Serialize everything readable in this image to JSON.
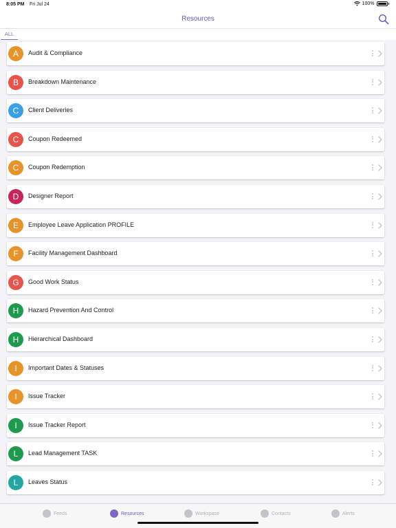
{
  "status_bar": {
    "time": "8:05 PM",
    "date": "Fri Jul 24",
    "battery": "100%"
  },
  "nav": {
    "title": "Resources"
  },
  "filter": {
    "tab": "ALL"
  },
  "items": [
    {
      "letter": "A",
      "label": "Audit & Compliance",
      "color": "#e8922a"
    },
    {
      "letter": "B",
      "label": "Breakdown Maintenance",
      "color": "#e8544c"
    },
    {
      "letter": "C",
      "label": "Client Deliveries",
      "color": "#3aa0e6"
    },
    {
      "letter": "C",
      "label": "Coupon Redeemed",
      "color": "#e8544c"
    },
    {
      "letter": "C",
      "label": "Coupon Redemption",
      "color": "#e8922a"
    },
    {
      "letter": "D",
      "label": "Designer Report",
      "color": "#c8265a"
    },
    {
      "letter": "E",
      "label": "Employee Leave Application PROFILE",
      "color": "#e8922a"
    },
    {
      "letter": "F",
      "label": "Facility Management Dashboard",
      "color": "#e8922a"
    },
    {
      "letter": "G",
      "label": "Good Work Status",
      "color": "#e8544c"
    },
    {
      "letter": "H",
      "label": "Hazard Prevention And Control",
      "color": "#1e9a4e"
    },
    {
      "letter": "H",
      "label": "Hierarchical Dashboard",
      "color": "#1e9a4e"
    },
    {
      "letter": "I",
      "label": "Important Dates & Statuses",
      "color": "#e8922a"
    },
    {
      "letter": "I",
      "label": "Issue Tracker",
      "color": "#e8922a"
    },
    {
      "letter": "I",
      "label": "Issue Tracker Report",
      "color": "#1e9a4e"
    },
    {
      "letter": "L",
      "label": "Lead Management TASK",
      "color": "#1e9a4e"
    },
    {
      "letter": "L",
      "label": "Leaves Status",
      "color": "#22a7a2"
    }
  ],
  "tabs": [
    {
      "label": "Feeds",
      "icon": "feeds-icon",
      "active": false
    },
    {
      "label": "Resources",
      "icon": "resources-icon",
      "active": true
    },
    {
      "label": "Workspace",
      "icon": "workspace-icon",
      "active": false
    },
    {
      "label": "Contacts",
      "icon": "contacts-icon",
      "active": false
    },
    {
      "label": "Alerts",
      "icon": "alerts-icon",
      "active": false
    }
  ],
  "colors": {
    "accent": "#6b57b7"
  }
}
